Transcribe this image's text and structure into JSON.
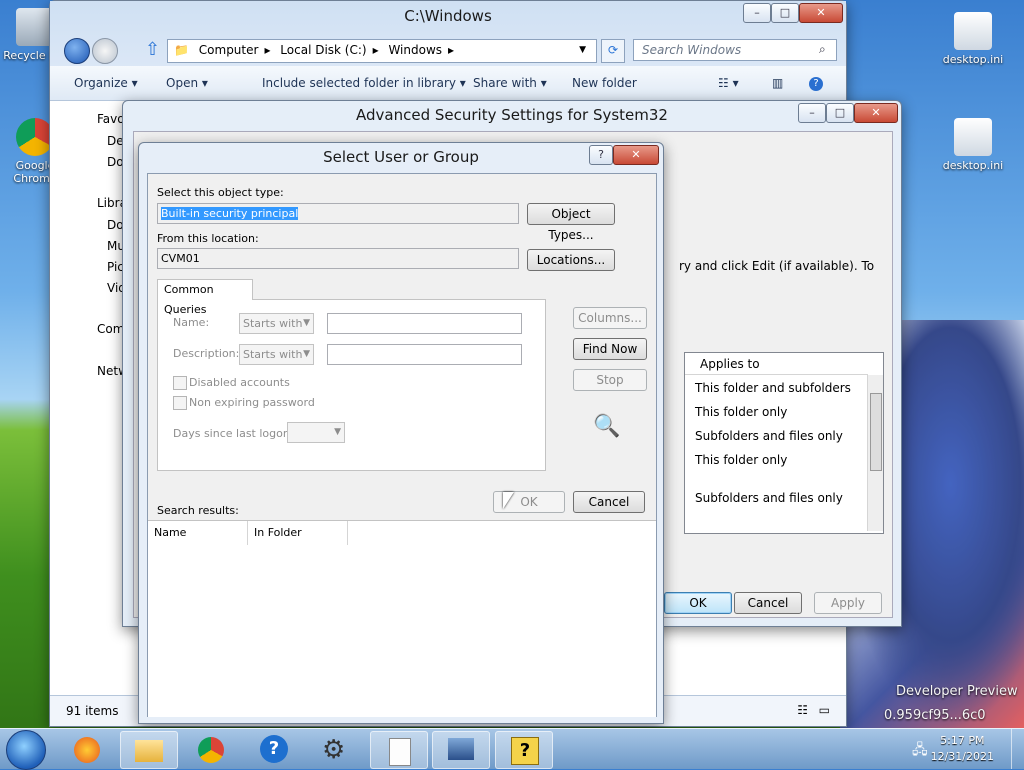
{
  "desktop": {
    "icons": [
      {
        "label": "Recycle Bin"
      },
      {
        "label": "Google Chrome"
      },
      {
        "label": "desktop.ini"
      },
      {
        "label": "desktop.ini"
      }
    ],
    "bg_text": [
      "Developer Preview",
      "0.959cf95...6c0"
    ]
  },
  "explorer": {
    "title": "C:\\Windows",
    "breadcrumb": [
      "Computer",
      "Local Disk (C:)",
      "Windows"
    ],
    "search_placeholder": "Search Windows",
    "commands": [
      "Organize",
      "Open",
      "Include selected folder in library",
      "Share with",
      "New folder"
    ],
    "nav": [
      "Favorites",
      "Desktop",
      "Downloads",
      "Libraries",
      "Documents",
      "Music",
      "Pictures",
      "Videos",
      "Computer",
      "Network"
    ],
    "status": "91 items"
  },
  "advanced": {
    "title": "Advanced Security Settings for System32",
    "instruction": "ry and click Edit (if available). To",
    "grid_header": "Applies to",
    "grid_rows": [
      "This folder and subfolders",
      "This folder only",
      "Subfolders and files only",
      "This folder only",
      "Subfolders and files only"
    ],
    "ok": "OK",
    "cancel": "Cancel",
    "apply": "Apply"
  },
  "select_dialog": {
    "title": "Select User or Group",
    "object_type_label": "Select this object type:",
    "object_type_value": "Built-in security principal",
    "object_types_button": "Object Types...",
    "location_label": "From this location:",
    "location_value": "CVM01",
    "locations_button": "Locations...",
    "tab": "Common Queries",
    "name_label": "Name:",
    "description_label": "Description:",
    "starts_with": "Starts with",
    "disabled_accounts": "Disabled accounts",
    "non_expiring": "Non expiring password",
    "days_since": "Days since last logon:",
    "columns_button": "Columns...",
    "find_now_button": "Find Now",
    "stop_button": "Stop",
    "ok_button": "OK",
    "cancel_button": "Cancel",
    "search_results_label": "Search results:",
    "col_name": "Name",
    "col_folder": "In Folder"
  },
  "taskbar": {
    "time": "5:17 PM",
    "date": "12/31/2021"
  }
}
